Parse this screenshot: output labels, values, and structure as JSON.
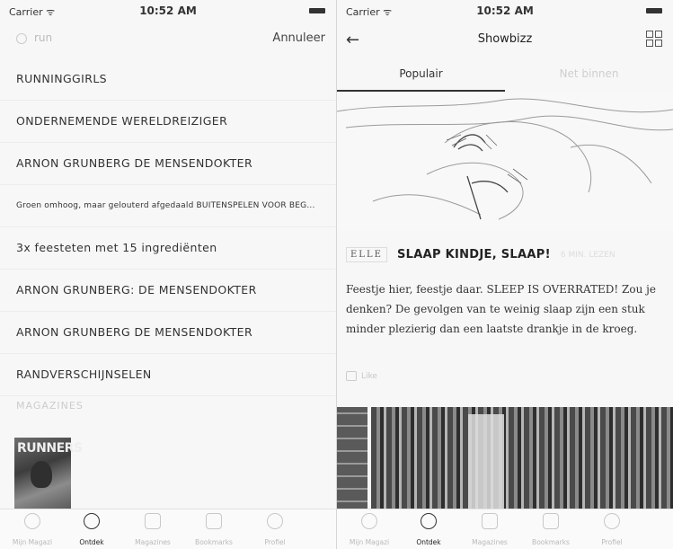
{
  "status": {
    "carrier": "Carrier ᯤ",
    "time": "10:52 AM"
  },
  "left": {
    "search": {
      "value": "run",
      "placeholder": "run"
    },
    "cancel_label": "Annuleer",
    "results": [
      {
        "label": "RUNNINGGIRLS"
      },
      {
        "label": "ONDERNEMENDE WERELDREIZIGER"
      },
      {
        "label": "ARNON GRUNBERG DE MENSENDOKTER"
      },
      {
        "label": "Groen omhoog, maar gelouterd afgedaald BUITENSPELEN VOOR BEG..."
      },
      {
        "label": "3x feesteten met 15 ingrediënten"
      },
      {
        "label": "ARNON GRUNBERG: DE MENSENDOKTER"
      },
      {
        "label": "ARNON GRUNBERG DE MENSENDOKTER"
      },
      {
        "label": "RANDVERSCHIJNSELEN"
      }
    ],
    "section_heading": "MAGAZINES",
    "magazine": {
      "title": "RUNNERS"
    },
    "tabbar": [
      {
        "label": "Mijn Magazi",
        "icon": "heart-icon"
      },
      {
        "label": "Ontdek",
        "icon": "search-icon"
      },
      {
        "label": "Magazines",
        "icon": "book-icon"
      },
      {
        "label": "Bookmarks",
        "icon": "bookmark-icon"
      },
      {
        "label": "Profiel",
        "icon": "profile-icon"
      }
    ]
  },
  "right": {
    "nav_title": "Showbizz",
    "tabs": {
      "popular": "Populair",
      "new": "Net binnen"
    },
    "article": {
      "brand": "ELLE",
      "headline": "SLAAP KINDJE, SLAAP!",
      "meta": "6 MIN. LEZEN",
      "body": "Feestje hier, feestje daar. SLEEP IS OVERRATED! Zou je denken? De gevolgen van te weinig slaap zijn een stuk minder plezierig dan een laatste drankje in de kroeg.",
      "like_label": "Like"
    },
    "tabbar": [
      {
        "label": "Mijn Magazi",
        "icon": "heart-icon"
      },
      {
        "label": "Ontdek",
        "icon": "search-icon"
      },
      {
        "label": "Magazines",
        "icon": "book-icon"
      },
      {
        "label": "Bookmarks",
        "icon": "bookmark-icon"
      },
      {
        "label": "Profiel",
        "icon": "profile-icon"
      }
    ],
    "active_tab": "Ontdek"
  }
}
